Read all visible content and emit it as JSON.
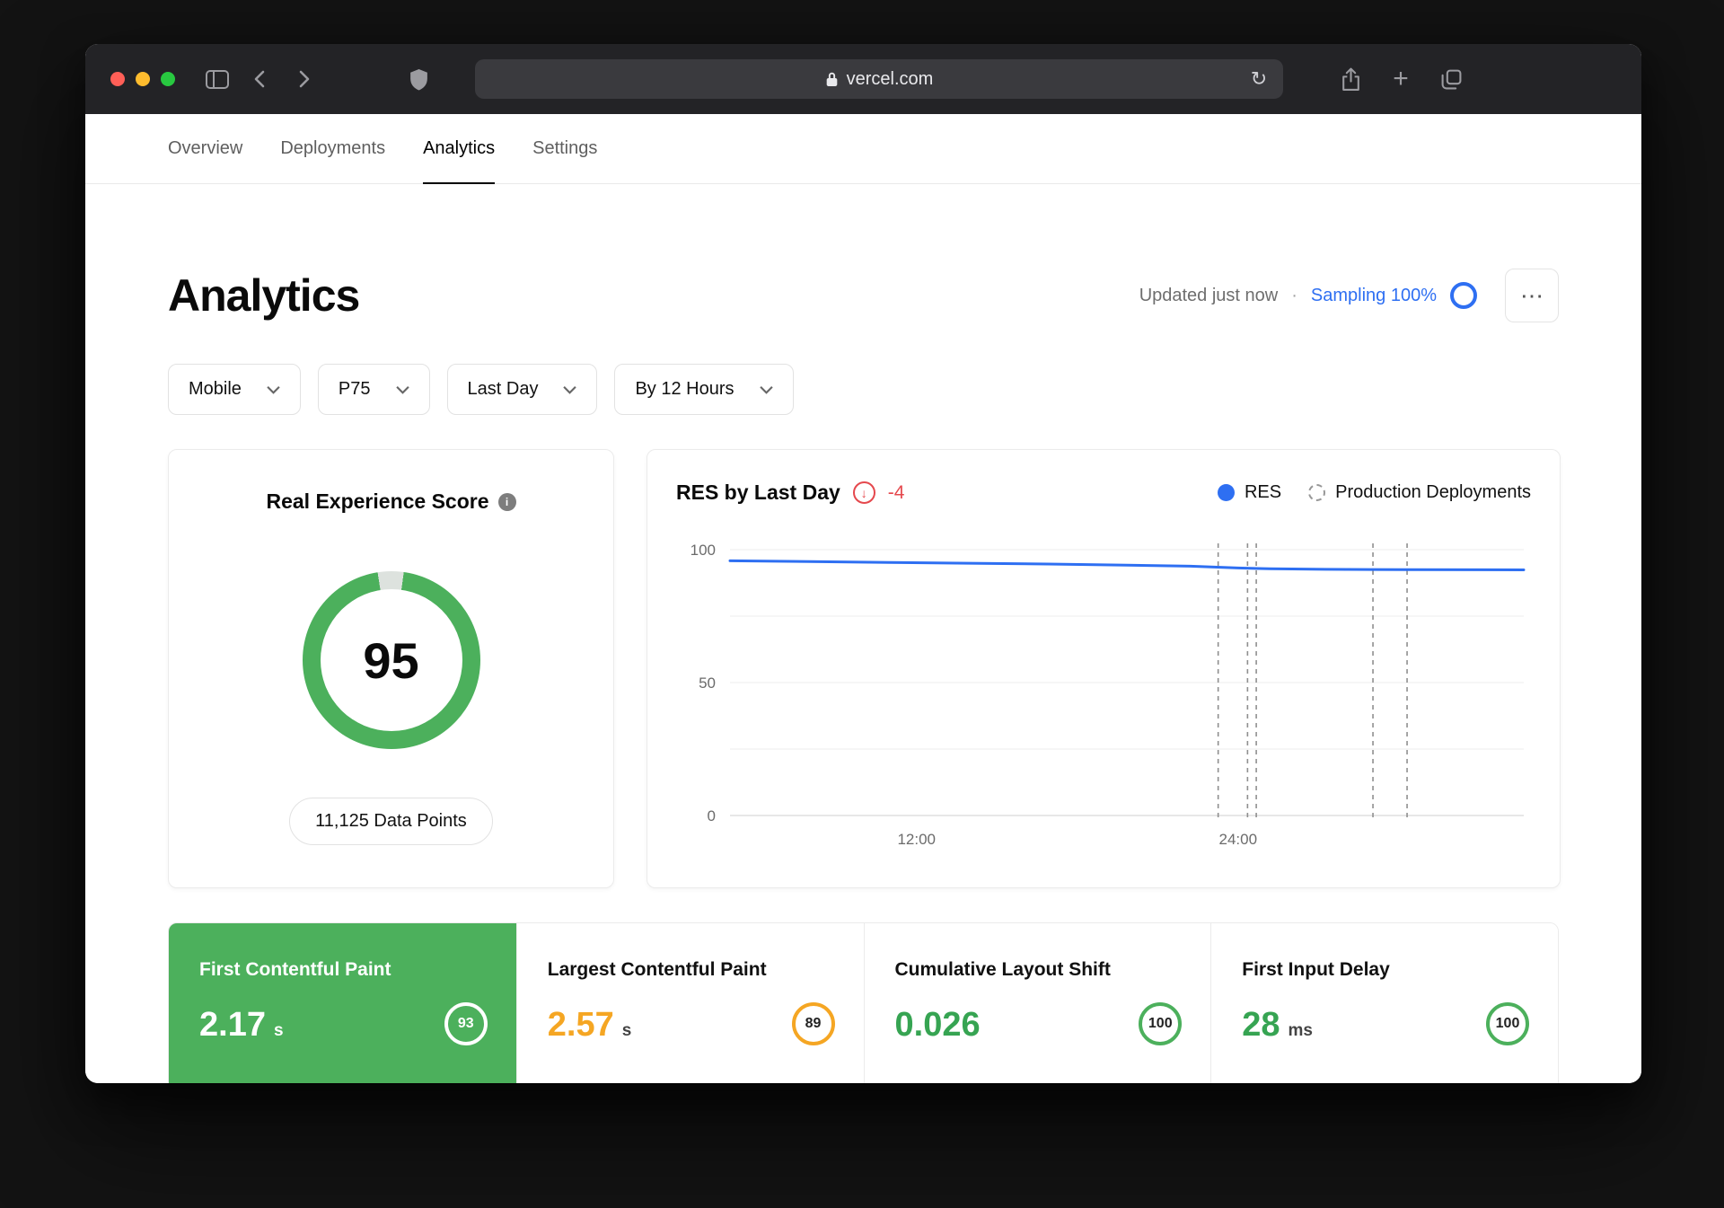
{
  "browser": {
    "url": "vercel.com",
    "refresh_icon": "↻",
    "new_tab_icon": "+"
  },
  "nav": {
    "tabs": [
      {
        "label": "Overview",
        "active": false
      },
      {
        "label": "Deployments",
        "active": false
      },
      {
        "label": "Analytics",
        "active": true
      },
      {
        "label": "Settings",
        "active": false
      }
    ]
  },
  "header": {
    "title": "Analytics",
    "updated_text": "Updated just now",
    "dot": "·",
    "sampling_label": "Sampling 100%",
    "more_label": "⋯"
  },
  "filters": [
    {
      "label": "Mobile"
    },
    {
      "label": "P75"
    },
    {
      "label": "Last Day"
    },
    {
      "label": "By 12 Hours"
    }
  ],
  "res_score_card": {
    "title": "Real Experience Score",
    "info_icon": "i",
    "score": "95",
    "data_points_label": "11,125 Data Points"
  },
  "chart_data": {
    "type": "line",
    "title": "RES by Last Day",
    "delta_arrow": "↓",
    "delta": "-4",
    "legend": [
      "RES",
      "Production Deployments"
    ],
    "legend_position": "top-right",
    "grid": true,
    "xlabel": "",
    "ylabel": "",
    "ylim": [
      0,
      100
    ],
    "ytick_labels": [
      100,
      50,
      0
    ],
    "gridline_values": [
      0,
      25,
      50,
      75,
      100
    ],
    "xticks": [
      {
        "label": "12:00",
        "pos": 0.235
      },
      {
        "label": "24:00",
        "pos": 0.64
      }
    ],
    "series": [
      {
        "name": "RES",
        "color": "#2e6ff2",
        "points": [
          [
            0,
            95.8
          ],
          [
            0.1,
            95.5
          ],
          [
            0.2,
            95.2
          ],
          [
            0.3,
            94.9
          ],
          [
            0.4,
            94.6
          ],
          [
            0.5,
            94.2
          ],
          [
            0.58,
            93.8
          ],
          [
            0.64,
            93.1
          ],
          [
            0.68,
            92.8
          ],
          [
            0.75,
            92.6
          ],
          [
            0.85,
            92.5
          ],
          [
            1,
            92.4
          ]
        ]
      }
    ],
    "deployment_markers_pos": [
      0.615,
      0.652,
      0.663,
      0.81,
      0.853
    ]
  },
  "metrics": [
    {
      "title": "First Contentful Paint",
      "value": "2.17",
      "unit": "s",
      "score": "93",
      "selected": true
    },
    {
      "title": "Largest Contentful Paint",
      "value": "2.57",
      "unit": "s",
      "score": "89",
      "selected": false
    },
    {
      "title": "Cumulative Layout Shift",
      "value": "0.026",
      "unit": "",
      "score": "100",
      "selected": false
    },
    {
      "title": "First Input Delay",
      "value": "28",
      "unit": "ms",
      "score": "100",
      "selected": false
    }
  ],
  "colors": {
    "green": "#4cb05c",
    "orange": "#f5a623",
    "blue": "#2e6ff2",
    "red": "#e5484d"
  }
}
